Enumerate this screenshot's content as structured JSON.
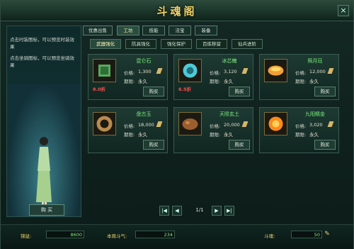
{
  "window": {
    "title": "斗魂阁",
    "close": "×"
  },
  "left_panel": {
    "tips": [
      "点击时装图标，可以预览时装效果",
      "点击坐骑图标，可以预览坐骑效果"
    ],
    "buy": "购 买"
  },
  "tabs": [
    "优惠出售",
    "工坊",
    "技能",
    "法宝",
    "装备"
  ],
  "active_tab_index": 1,
  "subtabs": [
    "武器强化",
    "防具强化",
    "强化保护",
    "百炼移留",
    "仙兵进阶"
  ],
  "active_subtab_index": 0,
  "labels": {
    "price": "价格:",
    "time": "期限:"
  },
  "items": [
    {
      "name": "昆仑石",
      "price": "1,300",
      "time": "永久",
      "discount": "8.0折",
      "buy": "购买",
      "icon": "jade-cube-icon"
    },
    {
      "name": "冰芯魄",
      "price": "3,120",
      "time": "永久",
      "discount": "6.5折",
      "buy": "购买",
      "icon": "ice-orb-icon"
    },
    {
      "name": "照月珏",
      "price": "12,000",
      "time": "永久",
      "discount": "",
      "buy": "购买",
      "icon": "moon-jade-icon"
    },
    {
      "name": "盘古玉",
      "price": "18,000",
      "time": "永久",
      "discount": "",
      "buy": "购买",
      "icon": "pangu-ring-icon"
    },
    {
      "name": "天陨玄土",
      "price": "20,000",
      "time": "永久",
      "discount": "",
      "buy": "购买",
      "icon": "meteor-earth-icon"
    },
    {
      "name": "九阳精金",
      "price": "3,020",
      "time": "永久",
      "discount": "",
      "buy": "购买",
      "icon": "sun-gold-icon"
    }
  ],
  "pager": {
    "page": "1/1",
    "first": "|◀",
    "prev": "◀",
    "next": "▶",
    "last": "▶|"
  },
  "bottom": {
    "label1": "锦鼠:",
    "value1": "8600",
    "label2": "本周斗气:",
    "value2": "234",
    "label3": "斗魂:",
    "value3": "50"
  },
  "colors": {
    "accent": "#f0d46a",
    "item_name": "#7cf07c",
    "discount": "#ff4d4d"
  }
}
